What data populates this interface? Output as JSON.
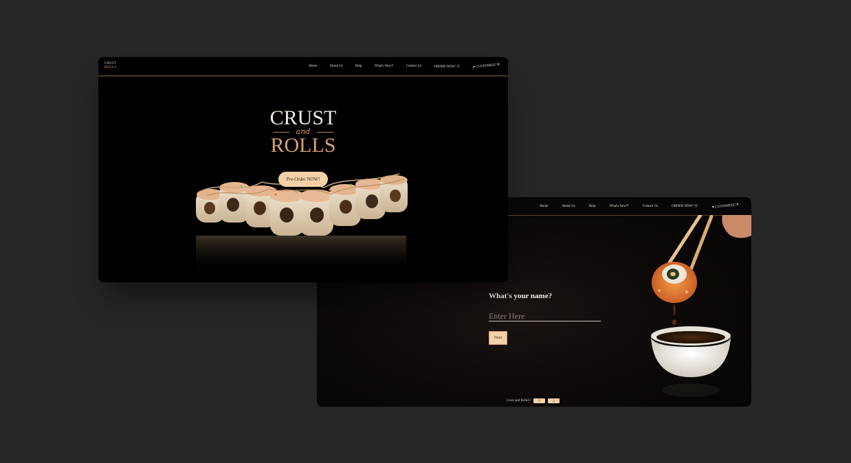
{
  "colors": {
    "background": "#262626",
    "card": "#000000",
    "accent_peach": "#f4d1a8",
    "accent_gold": "#d9a272"
  },
  "screen1": {
    "brand": {
      "line1": "CRUST",
      "line2": "ROLLS"
    },
    "nav": {
      "home": "Home",
      "about": "About Us",
      "help": "Help",
      "whats_new": "What's New?!",
      "contact": "Contact Us",
      "order": "ORDER NOW!",
      "customize": "CUSTOMIZE!"
    },
    "hero": {
      "title_top": "CRUST",
      "title_mid": "and",
      "title_bottom": "ROLLS",
      "cta": "Pre-Order NOW!"
    }
  },
  "screen2": {
    "nav": {
      "home": "Home",
      "about": "About Us",
      "help": "Help",
      "whats_new": "What's New?!",
      "contact": "Contact Us",
      "order": "ORDER NOW!",
      "customize": "CUSTOMIZE!"
    },
    "form": {
      "question": "What's your name?",
      "placeholder": "Enter Here",
      "next": "Next"
    },
    "footer": {
      "copyright": "Crust and Rolls©",
      "btn1": "⇧",
      "btn2": "⇩"
    }
  },
  "icons": {
    "cart": "cart-icon",
    "heart": "heart-icon"
  }
}
